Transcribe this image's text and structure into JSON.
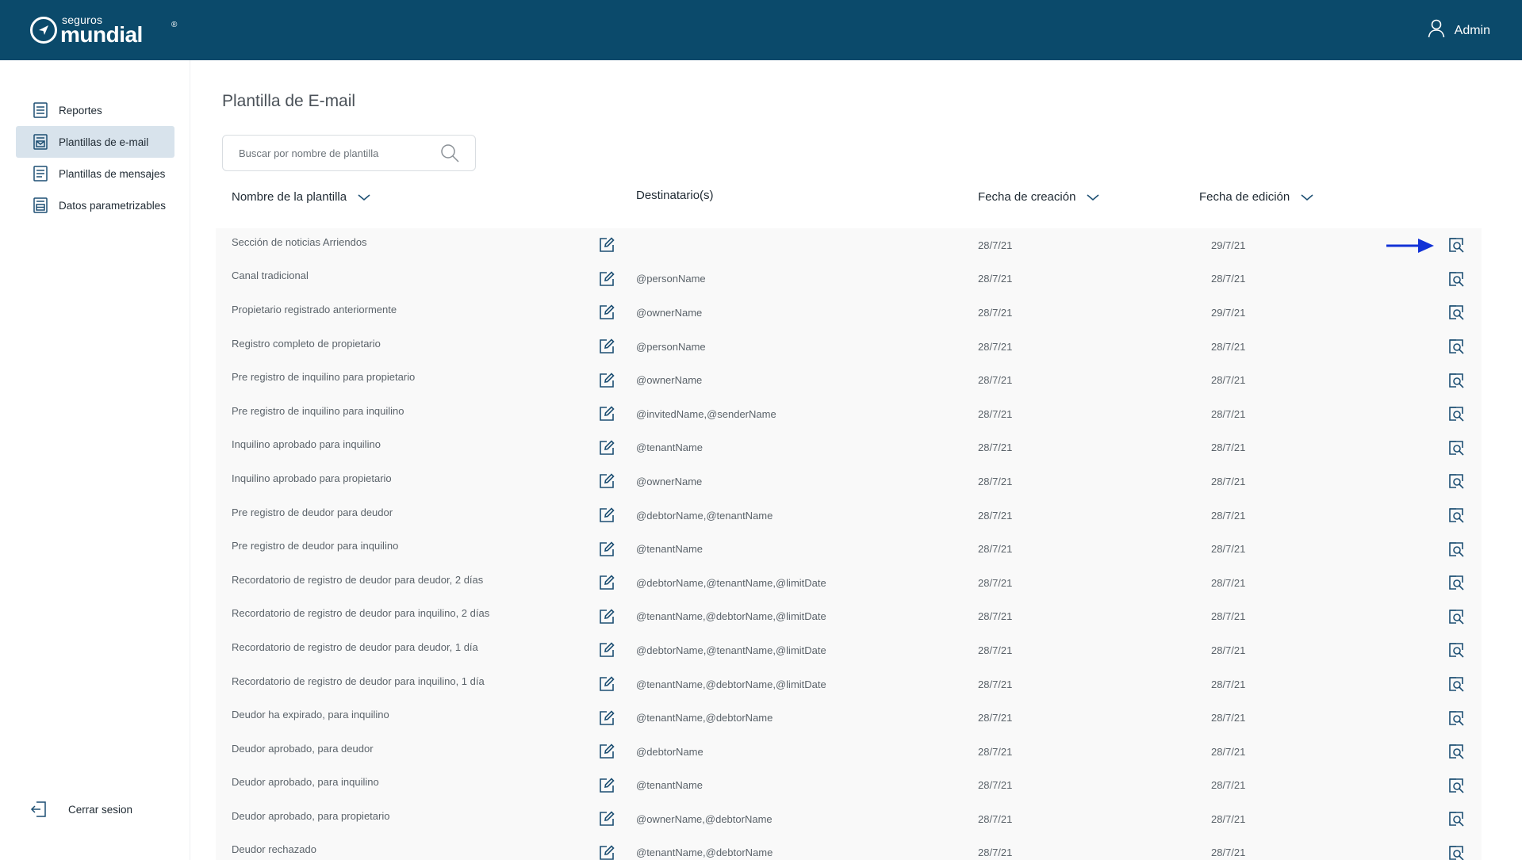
{
  "header": {
    "brand_small": "seguros",
    "brand_big": "mundial",
    "brand_reg": "®",
    "user_name": "Admin"
  },
  "sidebar": {
    "items": [
      {
        "label": "Reportes",
        "icon": "report-icon"
      },
      {
        "label": "Plantillas de e-mail",
        "icon": "email-template-icon",
        "active": true
      },
      {
        "label": "Plantillas de mensajes",
        "icon": "message-template-icon"
      },
      {
        "label": "Datos parametrizables",
        "icon": "parameters-icon"
      }
    ],
    "logout_label": "Cerrar sesion"
  },
  "main": {
    "title": "Plantilla de E-mail",
    "search_placeholder": "Buscar por nombre de plantilla",
    "columns": {
      "name": "Nombre de la plantilla",
      "recipients": "Destinatario(s)",
      "created": "Fecha de creación",
      "edited": "Fecha de edición"
    },
    "rows": [
      {
        "name": "Sección de noticias Arriendos",
        "recipients": "",
        "created": "28/7/21",
        "edited": "29/7/21"
      },
      {
        "name": "Canal tradicional",
        "recipients": "@personName",
        "created": "28/7/21",
        "edited": "28/7/21"
      },
      {
        "name": "Propietario registrado anteriormente",
        "recipients": "@ownerName",
        "created": "28/7/21",
        "edited": "29/7/21"
      },
      {
        "name": "Registro completo de propietario",
        "recipients": "@personName",
        "created": "28/7/21",
        "edited": "28/7/21"
      },
      {
        "name": "Pre registro de inquilino para propietario",
        "recipients": "@ownerName",
        "created": "28/7/21",
        "edited": "28/7/21"
      },
      {
        "name": "Pre registro de inquilino para inquilino",
        "recipients": "@invitedName,@senderName",
        "created": "28/7/21",
        "edited": "28/7/21"
      },
      {
        "name": "Inquilino aprobado para inquilino",
        "recipients": "@tenantName",
        "created": "28/7/21",
        "edited": "28/7/21"
      },
      {
        "name": "Inquilino aprobado para propietario",
        "recipients": "@ownerName",
        "created": "28/7/21",
        "edited": "28/7/21"
      },
      {
        "name": "Pre registro de deudor para deudor",
        "recipients": "@debtorName,@tenantName",
        "created": "28/7/21",
        "edited": "28/7/21"
      },
      {
        "name": "Pre registro de deudor para inquilino",
        "recipients": "@tenantName",
        "created": "28/7/21",
        "edited": "28/7/21"
      },
      {
        "name": "Recordatorio de registro de deudor para deudor, 2 días",
        "recipients": "@debtorName,@tenantName,@limitDate",
        "created": "28/7/21",
        "edited": "28/7/21"
      },
      {
        "name": "Recordatorio de registro de deudor para inquilino, 2 días",
        "recipients": "@tenantName,@debtorName,@limitDate",
        "created": "28/7/21",
        "edited": "28/7/21"
      },
      {
        "name": "Recordatorio de registro de deudor para deudor, 1 día",
        "recipients": "@debtorName,@tenantName,@limitDate",
        "created": "28/7/21",
        "edited": "28/7/21"
      },
      {
        "name": "Recordatorio de registro de deudor para inquilino, 1 día",
        "recipients": "@tenantName,@debtorName,@limitDate",
        "created": "28/7/21",
        "edited": "28/7/21"
      },
      {
        "name": "Deudor ha expirado, para inquilino",
        "recipients": "@tenantName,@debtorName",
        "created": "28/7/21",
        "edited": "28/7/21"
      },
      {
        "name": "Deudor aprobado, para deudor",
        "recipients": "@debtorName",
        "created": "28/7/21",
        "edited": "28/7/21"
      },
      {
        "name": "Deudor aprobado, para inquilino",
        "recipients": "@tenantName",
        "created": "28/7/21",
        "edited": "28/7/21"
      },
      {
        "name": "Deudor aprobado, para propietario",
        "recipients": "@ownerName,@debtorName",
        "created": "28/7/21",
        "edited": "28/7/21"
      },
      {
        "name": "Deudor rechazado",
        "recipients": "@tenantName,@debtorName",
        "created": "28/7/21",
        "edited": "28/7/21"
      }
    ]
  },
  "colors": {
    "header_bg": "#0b4a6b",
    "icon_blue": "#1d4f73",
    "active_bg": "#d8e3ec",
    "arrow_blue": "#1232d6"
  }
}
